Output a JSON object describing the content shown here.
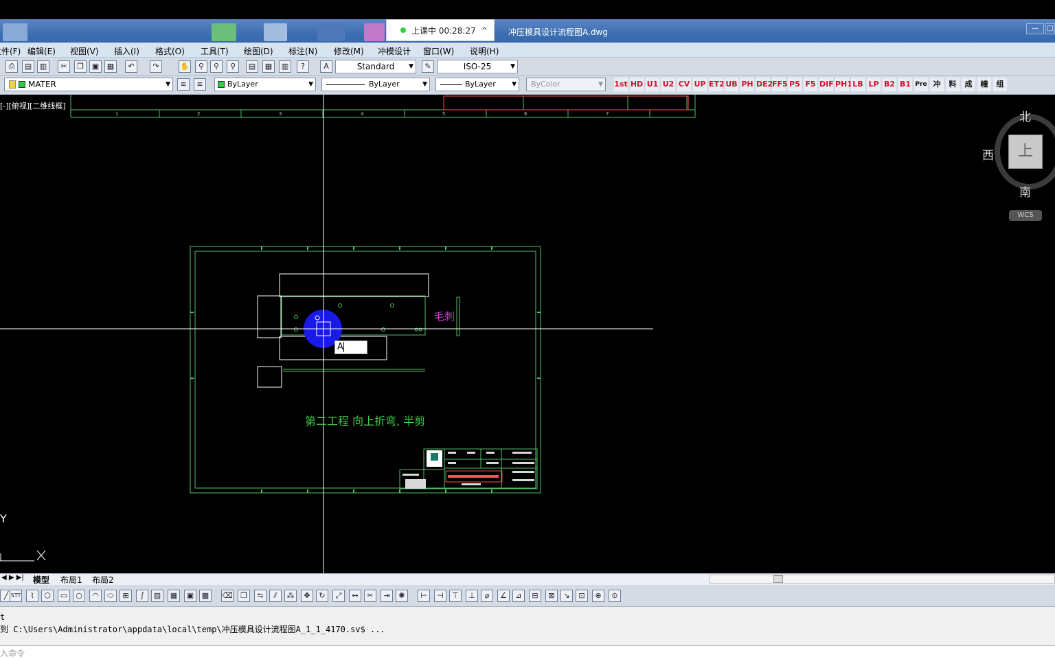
{
  "window": {
    "doc_title": "冲压模具设计流程图A.dwg",
    "recording_label": "上课中 00:28:27",
    "recording_chevron": "^",
    "btn_min": "—",
    "btn_max": "□"
  },
  "menu": [
    "文件(F)",
    "编辑(E)",
    "视图(V)",
    "插入(I)",
    "格式(O)",
    "工具(T)",
    "绘图(D)",
    "标注(N)",
    "修改(M)",
    "冲模设计",
    "窗口(W)",
    "说明(H)"
  ],
  "toolbar1": {
    "text_style": "Standard",
    "dim_style": "ISO-25"
  },
  "toolbar2": {
    "layer": "MATER",
    "color": "ByLayer",
    "linetype": "ByLayer",
    "lineweight": "ByLayer",
    "plot_style": "ByColor",
    "custom_tools": [
      "1st",
      "HD",
      "U1",
      "U2",
      "CV",
      "UP",
      "ET2",
      "UB",
      "PH",
      "DE2",
      "FF5",
      "P5",
      "F5",
      "DIF",
      "PH1",
      "LB",
      "LP",
      "B2",
      "B1",
      "Pre",
      "冲",
      "料",
      "成",
      "幢",
      "组"
    ]
  },
  "viewport": {
    "label": "[-][俯视][二维线框]"
  },
  "drawing": {
    "burr_label": "毛刺",
    "station_note": "第二工程 向上折弯, 半剪",
    "text_input_value": "A",
    "ucs_y": "Y"
  },
  "viewcube": {
    "north": "北",
    "south": "南",
    "west": "西",
    "top_face": "上",
    "wcs": "WCS"
  },
  "layout_tabs": [
    "模型",
    "布局1",
    "布局2"
  ],
  "command": {
    "line1": "t",
    "line2": "到 C:\\Users\\Administrator\\appdata\\local\\temp\\冲压模具设计流程图A_1_1_4170.sv$ ...",
    "prompt": "入命令"
  },
  "colors": {
    "frame": "#52c06a",
    "annotation": "#c83ad0",
    "note": "#3fd04a",
    "cursor": "#ffffff",
    "highlight": "#1a1ae6"
  }
}
